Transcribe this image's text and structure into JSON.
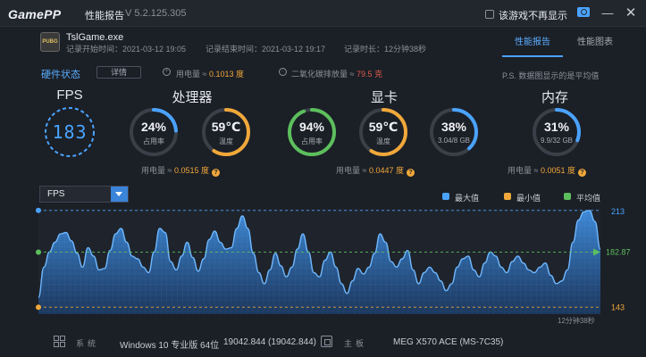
{
  "app": {
    "logo": "GamePP",
    "title": "性能报告",
    "version": "V 5.2.125.305",
    "checkbox_label": "该游戏不再显示",
    "icons": {
      "screenshot": "camera-icon",
      "minimize": "minimize-icon",
      "close": "close-icon"
    }
  },
  "game": {
    "icon_text": "PUBG",
    "name": "TslGame.exe",
    "record_start": "记录开始时间：2021-03-12 19:05",
    "record_end": "记录结束时间：2021-03-12 19:17",
    "record_duration": "记录时长：12分钟38秒"
  },
  "tabs": [
    {
      "label": "性能报告",
      "active": true
    },
    {
      "label": "性能图表",
      "active": false
    }
  ],
  "hardware": {
    "status_label": "硬件状态",
    "details_button": "详情",
    "power_total_label": "用电量 ≈",
    "power_total_value": "0.1013 度",
    "co2_label": "二氧化碳排放量 ≈",
    "co2_value": "79.5 克",
    "note": "P.S. 数据图显示的是平均值"
  },
  "sections": {
    "fps": {
      "title": "FPS",
      "value": "183"
    },
    "cpu": {
      "title": "处理器",
      "usage": {
        "value": "24%",
        "label": "占用率",
        "fraction": 0.24
      },
      "temp": {
        "value": "59℃",
        "label": "温度",
        "fraction": 0.59
      },
      "power_label": "用电量 ≈",
      "power_value": "0.0515 度"
    },
    "gpu": {
      "title": "显卡",
      "usage": {
        "value": "94%",
        "label": "占用率",
        "fraction": 0.94
      },
      "temp": {
        "value": "59℃",
        "label": "温度",
        "fraction": 0.59
      },
      "vram": {
        "value": "38%",
        "label": "3.04/8 GB",
        "fraction": 0.38
      },
      "power_label": "用电量 ≈",
      "power_value": "0.0447 度"
    },
    "memory": {
      "title": "内存",
      "usage": {
        "value": "31%",
        "label": "9.9/32 GB",
        "fraction": 0.31
      },
      "power_label": "用电量 ≈",
      "power_value": "0.0051 度"
    }
  },
  "colors": {
    "blue": "#4aa3ff",
    "green": "#5cbf5c",
    "yellow": "#f0a83a",
    "track": "#3a3f48"
  },
  "chart_controls": {
    "metric_selected": "FPS",
    "legend": [
      {
        "label": "最大值",
        "color": "#4aa3ff"
      },
      {
        "label": "最小值",
        "color": "#f0a83a"
      },
      {
        "label": "平均值",
        "color": "#5cbf5c"
      }
    ]
  },
  "chart_data": {
    "type": "area",
    "series": [
      {
        "values": [
          150,
          172,
          183,
          190,
          196,
          197,
          191,
          182,
          172,
          186,
          180,
          170,
          171,
          184,
          196,
          200,
          190,
          180,
          178,
          172,
          168,
          183,
          200,
          197,
          176,
          170,
          180,
          190,
          179,
          169,
          178,
          192,
          198,
          190,
          185,
          186,
          200,
          209,
          200,
          182,
          168,
          160,
          170,
          182,
          173,
          165,
          172,
          185,
          196,
          183,
          168,
          165,
          177,
          183,
          172,
          160,
          153,
          162,
          171,
          167,
          172,
          182,
          196,
          190,
          176,
          172,
          178,
          184,
          170,
          160,
          168,
          172,
          168,
          162,
          155,
          160,
          172,
          178,
          180,
          170,
          165,
          175,
          183,
          180,
          172,
          168,
          176,
          180,
          175,
          170,
          168,
          172,
          175,
          166,
          160,
          162,
          170,
          190,
          206,
          212,
          213,
          205,
          185
        ]
      }
    ],
    "markers": {
      "max": 213,
      "avg": 182.87,
      "min": 143
    },
    "duration_label": "12分钟38秒",
    "ylim": [
      138,
      218
    ]
  },
  "system": {
    "os_label": "系统",
    "os_value": "Windows 10 专业版 64位",
    "os_build": "19042.844 (19042.844)",
    "mb_label": "主板",
    "mb_value": "MEG X570 ACE (MS-7C35)"
  }
}
